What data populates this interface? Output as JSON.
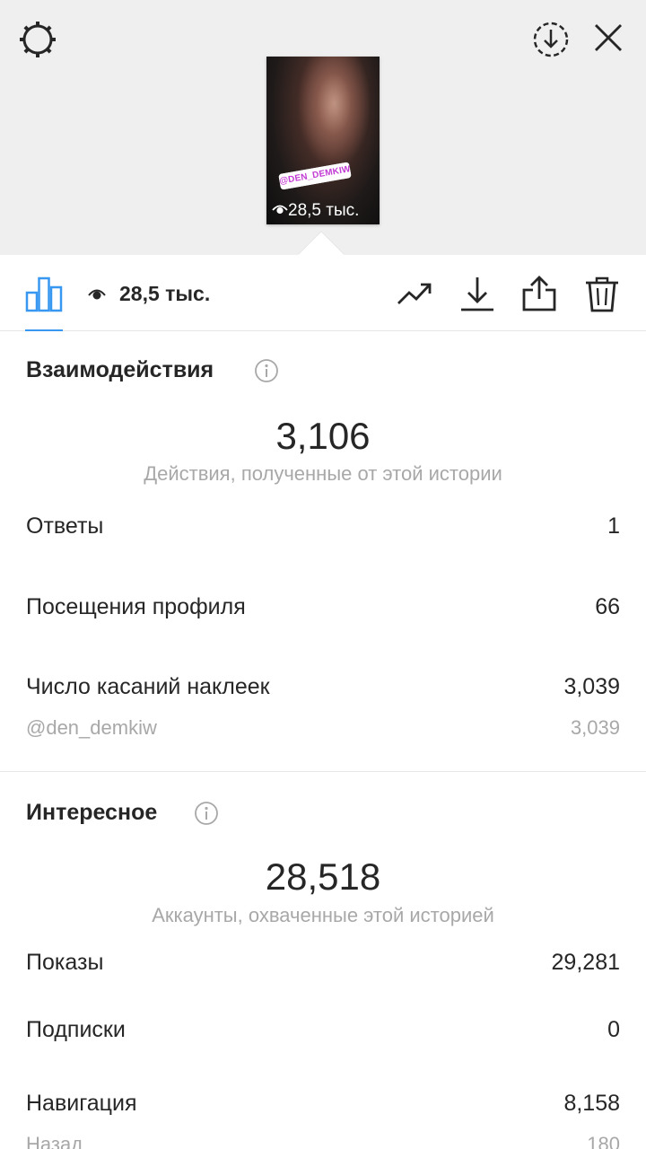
{
  "story": {
    "sticker_mention": "@DEN_DEMKIW",
    "views_overlay": "28,5 тыс."
  },
  "toolbar": {
    "views": "28,5 тыс.",
    "icons": [
      "insights-icon",
      "eye-icon",
      "trend-icon",
      "download-icon",
      "share-icon",
      "trash-icon"
    ]
  },
  "interactions": {
    "title": "Взаимодействия",
    "total": "3,106",
    "subtitle": "Действия, полученные от этой истории",
    "rows": [
      {
        "label": "Ответы",
        "value": "1"
      },
      {
        "label": "Посещения профиля",
        "value": "66"
      },
      {
        "label": "Число касаний наклеек",
        "value": "3,039"
      },
      {
        "label": "@den_demkiw",
        "value": "3,039"
      }
    ]
  },
  "discovery": {
    "title": "Интересное",
    "total": "28,518",
    "subtitle": "Аккаунты, охваченные этой историей",
    "rows": [
      {
        "label": "Показы",
        "value": "29,281"
      },
      {
        "label": "Подписки",
        "value": "0"
      },
      {
        "label": "Навигация",
        "value": "8,158"
      },
      {
        "label": "Назад",
        "value": "180"
      }
    ]
  },
  "colors": {
    "accent": "#3897f0",
    "text": "#262626",
    "secondary": "#a8a8a8",
    "top_bg": "#efefef"
  }
}
